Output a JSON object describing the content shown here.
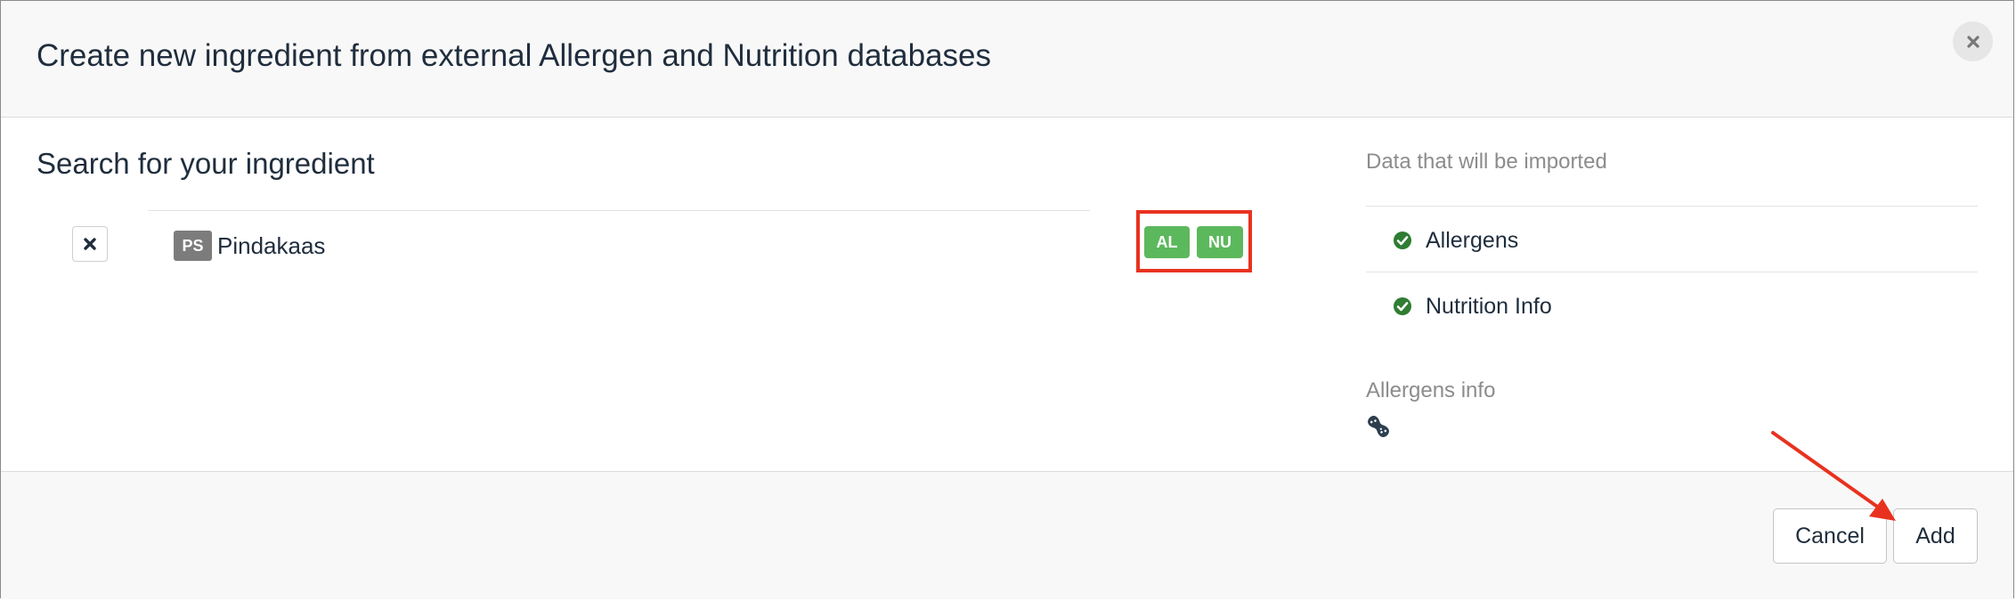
{
  "dialog": {
    "title": "Create new ingredient from external Allergen and Nutrition databases",
    "close_icon": "close-icon"
  },
  "search": {
    "heading": "Search for your ingredient",
    "result": {
      "source_badge": "PS",
      "name": "Pindakaas",
      "tags": [
        "AL",
        "NU"
      ],
      "remove_icon": "x-icon"
    }
  },
  "import_panel": {
    "heading": "Data that will be imported",
    "items": [
      {
        "label": "Allergens",
        "icon": "check-circle-icon"
      },
      {
        "label": "Nutrition Info",
        "icon": "check-circle-icon"
      }
    ],
    "allergens_heading": "Allergens info",
    "allergen_icons": [
      "peanut-icon"
    ]
  },
  "footer": {
    "cancel_label": "Cancel",
    "add_label": "Add"
  },
  "colors": {
    "tag_green": "#5cb85c",
    "check_green": "#2e7d32",
    "annotation_red": "#e8321f",
    "badge_gray": "#7c7c7c"
  }
}
